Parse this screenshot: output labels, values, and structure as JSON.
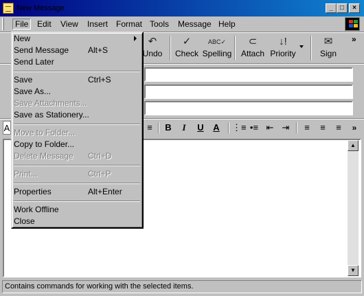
{
  "window": {
    "title": "New Message",
    "minimize": "_",
    "maximize": "□",
    "close": "×"
  },
  "menubar": {
    "items": [
      "File",
      "Edit",
      "View",
      "Insert",
      "Format",
      "Tools",
      "Message",
      "Help"
    ]
  },
  "toolbar": {
    "undo_label": "Undo",
    "check_label": "Check",
    "spelling_label": "Spelling",
    "attach_label": "Attach",
    "priority_label": "Priority",
    "sign_label": "Sign",
    "overflow": "»"
  },
  "format_toolbar": {
    "font_partial": "A",
    "bold": "B",
    "italic": "I",
    "underline": "U",
    "font_color": "A",
    "overflow": "»"
  },
  "file_menu": {
    "items": [
      {
        "label": "New",
        "shortcut": "",
        "disabled": false,
        "submenu": true
      },
      {
        "label": "Send Message",
        "shortcut": "Alt+S",
        "disabled": false
      },
      {
        "label": "Send Later",
        "shortcut": "",
        "disabled": false
      },
      {
        "label": "Save",
        "shortcut": "Ctrl+S",
        "disabled": false
      },
      {
        "label": "Save As...",
        "shortcut": "",
        "disabled": false
      },
      {
        "label": "Save Attachments...",
        "shortcut": "",
        "disabled": true
      },
      {
        "label": "Save as Stationery...",
        "shortcut": "",
        "disabled": false
      },
      {
        "label": "Move to Folder...",
        "shortcut": "",
        "disabled": true
      },
      {
        "label": "Copy to Folder...",
        "shortcut": "",
        "disabled": false
      },
      {
        "label": "Delete Message",
        "shortcut": "Ctrl+D",
        "disabled": true
      },
      {
        "label": "Print...",
        "shortcut": "Ctrl+P",
        "disabled": true
      },
      {
        "label": "Properties",
        "shortcut": "Alt+Enter",
        "disabled": false
      },
      {
        "label": "Work Offline",
        "shortcut": "",
        "disabled": false
      },
      {
        "label": "Close",
        "shortcut": "",
        "disabled": false
      }
    ]
  },
  "status": {
    "text": "Contains commands for working with the selected items."
  }
}
